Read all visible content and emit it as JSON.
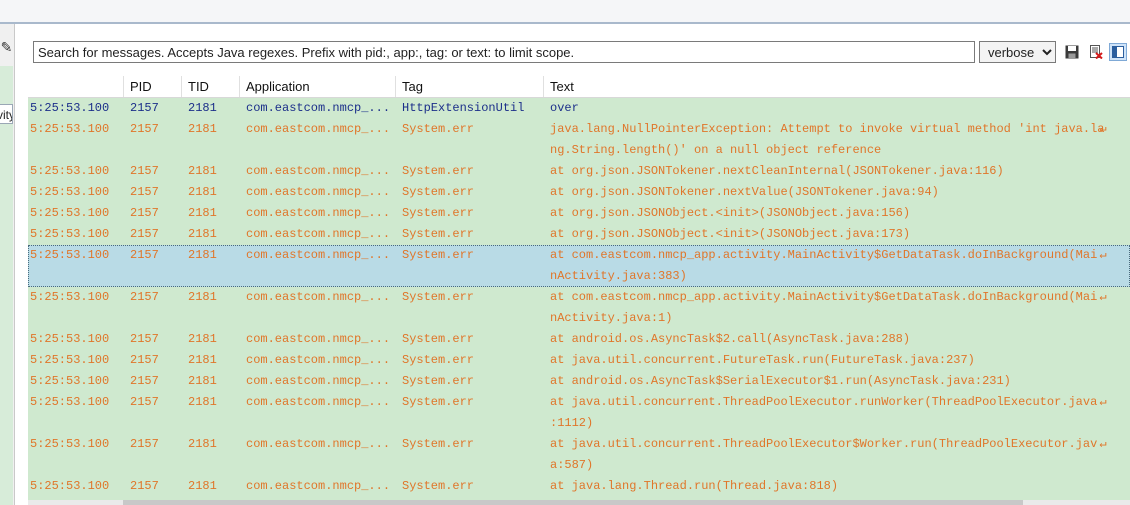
{
  "search": {
    "placeholder": "Search for messages. Accepts Java regexes. Prefix with pid:, app:, tag: or text: to limit scope."
  },
  "log_level": {
    "selected": "verbose"
  },
  "left_panel": {
    "tab_fragment": "vity"
  },
  "toolbar": {
    "icons": [
      "save-icon",
      "clear-log-icon",
      "toggle-panel-icon"
    ]
  },
  "table": {
    "columns": [
      "",
      "PID",
      "TID",
      "Application",
      "Tag",
      "Text"
    ],
    "rows": [
      {
        "time": "5:25:53.100",
        "pid": "2157",
        "tid": "2181",
        "app": "com.eastcom.nmcp_...",
        "tag": "HttpExtensionUtil",
        "text": [
          "over"
        ],
        "level": "info"
      },
      {
        "time": "5:25:53.100",
        "pid": "2157",
        "tid": "2181",
        "app": "com.eastcom.nmcp_...",
        "tag": "System.err",
        "text": [
          "java.lang.NullPointerException: Attempt to invoke virtual method 'int java.la",
          "ng.String.length()' on a null object reference"
        ],
        "level": "warn"
      },
      {
        "time": "5:25:53.100",
        "pid": "2157",
        "tid": "2181",
        "app": "com.eastcom.nmcp_...",
        "tag": "System.err",
        "text": [
          "at org.json.JSONTokener.nextCleanInternal(JSONTokener.java:116)"
        ],
        "level": "warn"
      },
      {
        "time": "5:25:53.100",
        "pid": "2157",
        "tid": "2181",
        "app": "com.eastcom.nmcp_...",
        "tag": "System.err",
        "text": [
          "at org.json.JSONTokener.nextValue(JSONTokener.java:94)"
        ],
        "level": "warn"
      },
      {
        "time": "5:25:53.100",
        "pid": "2157",
        "tid": "2181",
        "app": "com.eastcom.nmcp_...",
        "tag": "System.err",
        "text": [
          "at org.json.JSONObject.<init>(JSONObject.java:156)"
        ],
        "level": "warn"
      },
      {
        "time": "5:25:53.100",
        "pid": "2157",
        "tid": "2181",
        "app": "com.eastcom.nmcp_...",
        "tag": "System.err",
        "text": [
          "at org.json.JSONObject.<init>(JSONObject.java:173)"
        ],
        "level": "warn"
      },
      {
        "time": "5:25:53.100",
        "pid": "2157",
        "tid": "2181",
        "app": "com.eastcom.nmcp_...",
        "tag": "System.err",
        "text": [
          "at com.eastcom.nmcp_app.activity.MainActivity$GetDataTask.doInBackground(Mai",
          "nActivity.java:383)"
        ],
        "level": "warn",
        "selected": true
      },
      {
        "time": "5:25:53.100",
        "pid": "2157",
        "tid": "2181",
        "app": "com.eastcom.nmcp_...",
        "tag": "System.err",
        "text": [
          "at com.eastcom.nmcp_app.activity.MainActivity$GetDataTask.doInBackground(Mai",
          "nActivity.java:1)"
        ],
        "level": "warn"
      },
      {
        "time": "5:25:53.100",
        "pid": "2157",
        "tid": "2181",
        "app": "com.eastcom.nmcp_...",
        "tag": "System.err",
        "text": [
          "at android.os.AsyncTask$2.call(AsyncTask.java:288)"
        ],
        "level": "warn"
      },
      {
        "time": "5:25:53.100",
        "pid": "2157",
        "tid": "2181",
        "app": "com.eastcom.nmcp_...",
        "tag": "System.err",
        "text": [
          "at java.util.concurrent.FutureTask.run(FutureTask.java:237)"
        ],
        "level": "warn"
      },
      {
        "time": "5:25:53.100",
        "pid": "2157",
        "tid": "2181",
        "app": "com.eastcom.nmcp_...",
        "tag": "System.err",
        "text": [
          "at android.os.AsyncTask$SerialExecutor$1.run(AsyncTask.java:231)"
        ],
        "level": "warn"
      },
      {
        "time": "5:25:53.100",
        "pid": "2157",
        "tid": "2181",
        "app": "com.eastcom.nmcp_...",
        "tag": "System.err",
        "text": [
          "at java.util.concurrent.ThreadPoolExecutor.runWorker(ThreadPoolExecutor.java",
          ":1112)"
        ],
        "level": "warn"
      },
      {
        "time": "5:25:53.100",
        "pid": "2157",
        "tid": "2181",
        "app": "com.eastcom.nmcp_...",
        "tag": "System.err",
        "text": [
          "at java.util.concurrent.ThreadPoolExecutor$Worker.run(ThreadPoolExecutor.jav",
          "a:587)"
        ],
        "level": "warn"
      },
      {
        "time": "5:25:53.100",
        "pid": "2157",
        "tid": "2181",
        "app": "com.eastcom.nmcp_...",
        "tag": "System.err",
        "text": [
          "at java.lang.Thread.run(Thread.java:818)"
        ],
        "level": "warn"
      }
    ]
  },
  "colors": {
    "row_bg": "#cfe9cf",
    "warn_text": "#e0762a",
    "info_text": "#1c2f8a",
    "selected_bg": "#b9dbe6"
  }
}
